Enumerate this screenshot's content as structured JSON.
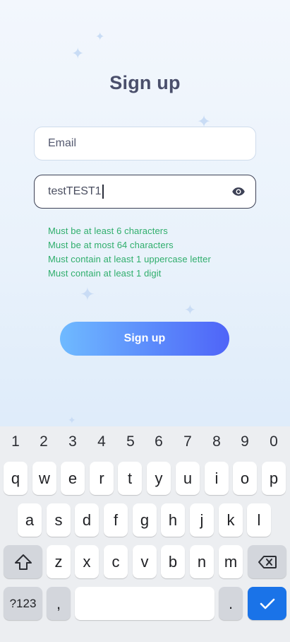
{
  "screen": {
    "title": "Sign up",
    "email": {
      "placeholder": "Email"
    },
    "password": {
      "value": "testTEST1"
    },
    "rules": [
      "Must be at least 6 characters",
      "Must be at most 64 characters",
      "Must contain at least 1 uppercase letter",
      "Must contain at least 1 digit"
    ],
    "signup_button": "Sign up",
    "colors": {
      "rule_ok": "#2fae6c",
      "button_start": "#6fbaff",
      "button_end": "#4f64f8"
    }
  },
  "keyboard": {
    "numbers": [
      "1",
      "2",
      "3",
      "4",
      "5",
      "6",
      "7",
      "8",
      "9",
      "0"
    ],
    "row1": [
      "q",
      "w",
      "e",
      "r",
      "t",
      "y",
      "u",
      "i",
      "o",
      "p"
    ],
    "row2": [
      "a",
      "s",
      "d",
      "f",
      "g",
      "h",
      "j",
      "k",
      "l"
    ],
    "row3": [
      "z",
      "x",
      "c",
      "v",
      "b",
      "n",
      "m"
    ],
    "symbols_key": "?123",
    "comma_key": ",",
    "period_key": ".",
    "icons": {
      "shift": "shift-icon",
      "backspace": "backspace-icon",
      "done": "check-icon"
    }
  }
}
